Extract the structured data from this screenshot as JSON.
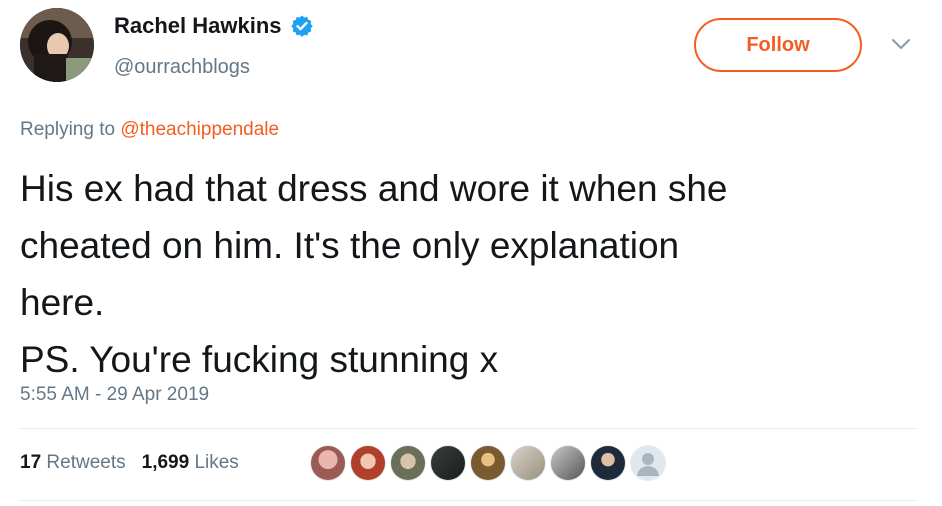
{
  "author": {
    "name": "Rachel Hawkins",
    "handle": "@ourrachblogs",
    "verified": true,
    "verified_icon": "verified-badge-icon"
  },
  "follow_label": "Follow",
  "reply": {
    "prefix": "Replying to ",
    "mention": "@theachippendale"
  },
  "tweet": {
    "text": "His ex had that dress and wore it when she\ncheated on him.  It's the only explanation\nhere.\nPS. You're fucking stunning x"
  },
  "timestamp": "5:55 AM - 29 Apr 2019",
  "stats": {
    "retweets_count": "17",
    "retweets_label": "Retweets",
    "likes_count": "1,699",
    "likes_label": "Likes"
  },
  "likers": [
    {
      "name": "liker-avatar-1"
    },
    {
      "name": "liker-avatar-2"
    },
    {
      "name": "liker-avatar-3"
    },
    {
      "name": "liker-avatar-4"
    },
    {
      "name": "liker-avatar-5"
    },
    {
      "name": "liker-avatar-6"
    },
    {
      "name": "liker-avatar-7"
    },
    {
      "name": "liker-avatar-8"
    },
    {
      "name": "liker-avatar-9"
    }
  ],
  "colors": {
    "accent": "#f45d22",
    "verified": "#1da1f2",
    "secondary_text": "#657786",
    "divider": "#e6ecf0"
  }
}
